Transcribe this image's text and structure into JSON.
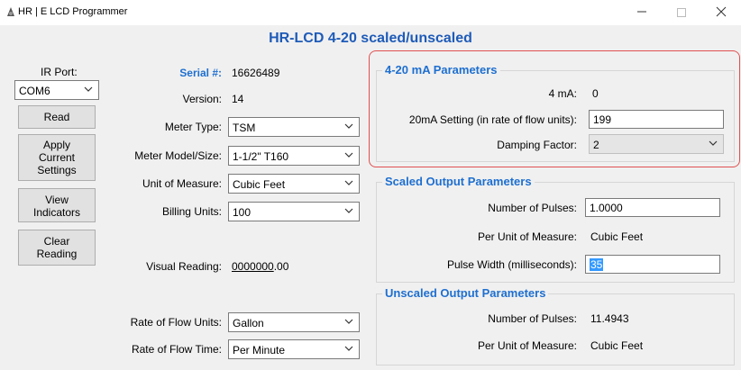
{
  "window": {
    "title": "HR | E LCD Programmer"
  },
  "main_title": "HR-LCD 4-20 scaled/unscaled",
  "left": {
    "ir_port_label": "IR Port:",
    "ir_port_value": "COM6",
    "read_button": "Read",
    "apply_button": [
      "Apply",
      "Current",
      "Settings"
    ],
    "view_button": [
      "View",
      "Indicators"
    ],
    "clear_button": [
      "Clear",
      "Reading"
    ]
  },
  "fields": {
    "serial_label": "Serial #:",
    "serial_value": "16626489",
    "version_label": "Version:",
    "version_value": "14",
    "meter_type_label": "Meter Type:",
    "meter_type_value": "TSM",
    "meter_model_label": "Meter Model/Size:",
    "meter_model_value": "1-1/2\" T160",
    "unit_measure_label": "Unit of Measure:",
    "unit_measure_value": "Cubic Feet",
    "billing_units_label": "Billing Units:",
    "billing_units_value": "100",
    "visual_reading_label": "Visual Reading:",
    "visual_reading_underlined": "0000000",
    "visual_reading_rest": ".00",
    "rate_flow_units_label": "Rate of Flow Units:",
    "rate_flow_units_value": "Gallon",
    "rate_flow_time_label": "Rate of Flow Time:",
    "rate_flow_time_value": "Per Minute"
  },
  "ma_group": {
    "title": "4-20 mA Parameters",
    "ma4_label": "4 mA:",
    "ma4_value": "0",
    "ma20_label": "20mA Setting (in rate of flow units):",
    "ma20_value": "199",
    "damping_label": "Damping Factor:",
    "damping_value": "2"
  },
  "scaled_group": {
    "title": "Scaled Output Parameters",
    "pulses_label": "Number of Pulses:",
    "pulses_value": "1.0000",
    "per_unit_label": "Per Unit of Measure:",
    "per_unit_value": "Cubic Feet",
    "pulse_width_label": "Pulse Width (milliseconds):",
    "pulse_width_value": "35"
  },
  "unscaled_group": {
    "title": "Unscaled Output Parameters",
    "pulses_label": "Number of Pulses:",
    "pulses_value": "11.4943",
    "per_unit_label": "Per Unit of Measure:",
    "per_unit_value": "Cubic Feet"
  },
  "colors": {
    "accent_blue": "#1e6fd0",
    "highlight_red": "#e05050",
    "selection": "#3399ff"
  }
}
